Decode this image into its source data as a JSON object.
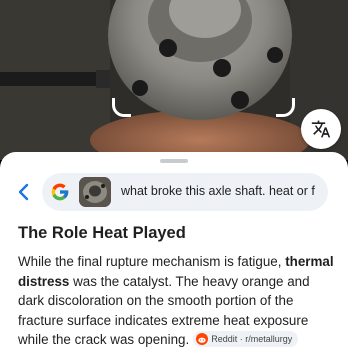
{
  "search": {
    "query": "what broke this axle shaft. heat or f"
  },
  "answer": {
    "heading": "The Role Heat Played",
    "text_part1": "While the final rupture mechanism is fatigue, ",
    "text_bold": "thermal distress",
    "text_part2": " was the catalyst. The heavy orange and dark discoloration on the smooth portion of the fracture surface indicates extreme heat exposure while the crack was opening.",
    "source_chip": "Reddit · r/metallurgy"
  },
  "icons": {
    "translate": "translate-icon",
    "back": "back-arrow-icon",
    "google": "google-logo",
    "source": "reddit-icon"
  },
  "colors": {
    "accent": "#1a73e8",
    "reddit": "#ff4500",
    "pill_bg": "#eef1f6"
  }
}
